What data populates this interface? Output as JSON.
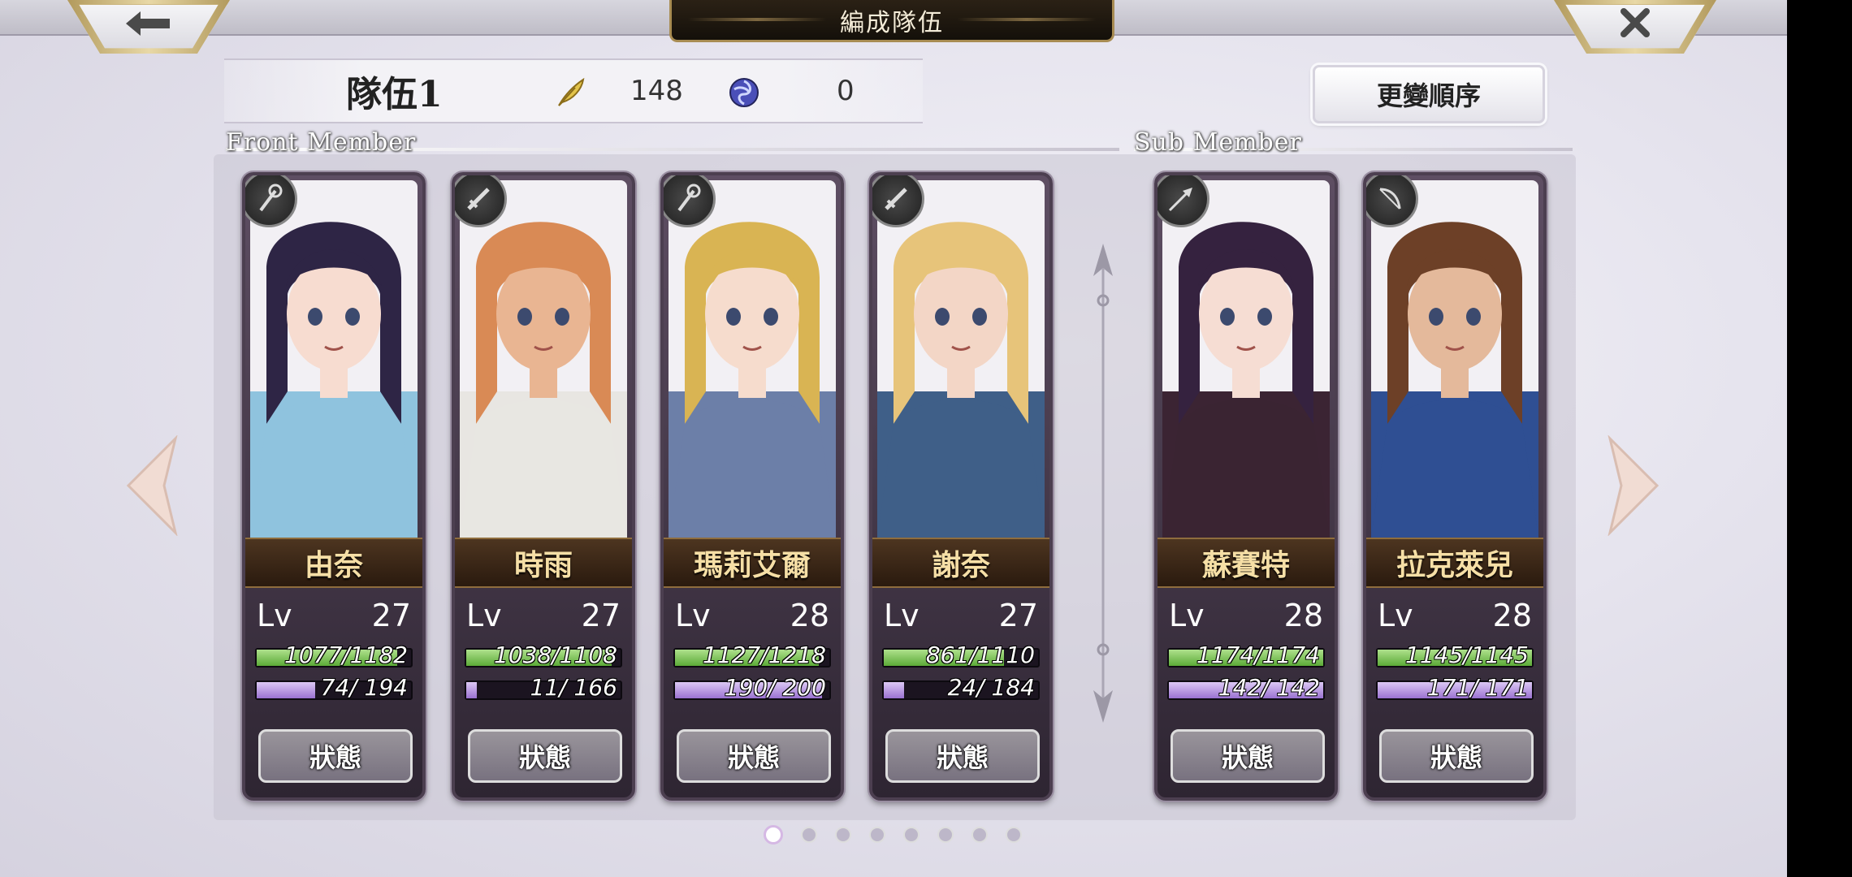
{
  "header": {
    "title": "編成隊伍",
    "back_icon": "arrow-left-icon",
    "close_icon": "close-x-icon"
  },
  "party": {
    "name": "隊伍1",
    "feather_count": "148",
    "orb_count": "0",
    "reorder_label": "更變順序"
  },
  "sections": {
    "front_label": "Front Member",
    "sub_label": "Sub Member"
  },
  "members": [
    {
      "name": "由奈",
      "lv_label": "Lv",
      "lv": "27",
      "hp_text": "1077/1182",
      "hp_fraction": 0.911,
      "mp_text": "74/ 194",
      "mp_fraction": 0.381,
      "weapon_icon": "staff-icon",
      "status_label": "狀態",
      "hair": "#2e2545",
      "skin": "#f7dcd0",
      "robe": "#8fc3de"
    },
    {
      "name": "時雨",
      "lv_label": "Lv",
      "lv": "27",
      "hp_text": "1038/1108",
      "hp_fraction": 0.937,
      "mp_text": "11/ 166",
      "mp_fraction": 0.066,
      "weapon_icon": "sword-icon",
      "status_label": "狀態",
      "hair": "#d98a55",
      "skin": "#e9b592",
      "robe": "#e8e6e2"
    },
    {
      "name": "瑪莉艾爾",
      "lv_label": "Lv",
      "lv": "28",
      "hp_text": "1127/1218",
      "hp_fraction": 0.925,
      "mp_text": "190/ 200",
      "mp_fraction": 0.95,
      "weapon_icon": "staff-icon",
      "status_label": "狀態",
      "hair": "#d9b453",
      "skin": "#f6dccd",
      "robe": "#6c7fa8"
    },
    {
      "name": "謝奈",
      "lv_label": "Lv",
      "lv": "27",
      "hp_text": "861/1110",
      "hp_fraction": 0.776,
      "mp_text": "24/ 184",
      "mp_fraction": 0.13,
      "weapon_icon": "sword-icon",
      "status_label": "狀態",
      "hair": "#e7c47a",
      "skin": "#f3d6c6",
      "robe": "#3f5f88"
    },
    {
      "name": "蘇賽特",
      "lv_label": "Lv",
      "lv": "28",
      "hp_text": "1174/1174",
      "hp_fraction": 1.0,
      "mp_text": "142/ 142",
      "mp_fraction": 1.0,
      "weapon_icon": "spear-icon",
      "status_label": "狀態",
      "hair": "#35223f",
      "skin": "#f6ddd3",
      "robe": "#3b2433"
    },
    {
      "name": "拉克萊兒",
      "lv_label": "Lv",
      "lv": "28",
      "hp_text": "1145/1145",
      "hp_fraction": 1.0,
      "mp_text": "171/ 171",
      "mp_fraction": 1.0,
      "weapon_icon": "bow-icon",
      "status_label": "狀態",
      "hair": "#6d4027",
      "skin": "#e4b99b",
      "robe": "#2f4f93"
    }
  ],
  "pager": {
    "total": 8,
    "active": 0
  },
  "colors": {
    "hp": "#6cbf45",
    "mp": "#a987d8",
    "name_plate_text": "#f6dfa6",
    "accent_gold": "#a88c52"
  }
}
